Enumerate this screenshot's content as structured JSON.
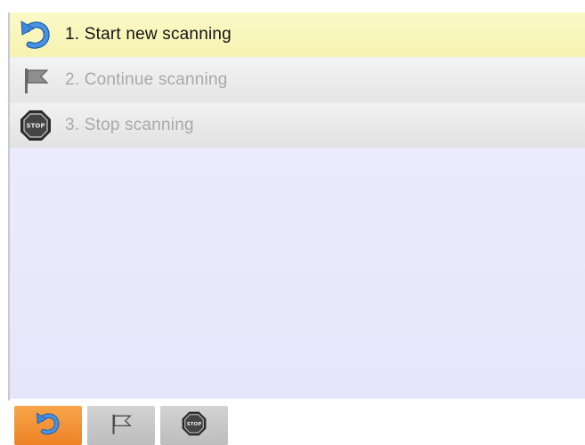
{
  "menu": {
    "items": [
      {
        "label": "1. Start new scanning",
        "icon": "restart-arrow-icon",
        "state": "active"
      },
      {
        "label": "2. Continue scanning",
        "icon": "flag-icon",
        "state": "disabled"
      },
      {
        "label": "3. Stop scanning",
        "icon": "stop-sign-icon",
        "state": "disabled"
      }
    ]
  },
  "toolbar": {
    "buttons": [
      {
        "icon": "restart-arrow-icon",
        "state": "active"
      },
      {
        "icon": "flag-icon",
        "state": "normal"
      },
      {
        "icon": "stop-sign-icon",
        "state": "normal"
      }
    ]
  },
  "stop_sign": {
    "text": "STOP"
  },
  "colors": {
    "highlight_row": "#f8f5b8",
    "disabled_row": "#ececec",
    "panel_background": "#eaeafb",
    "active_text": "#141414",
    "disabled_text": "#a9a9a9",
    "active_button": "#f29339",
    "normal_button": "#c8c8c8",
    "restart_icon_blue": "#3d86d8"
  }
}
